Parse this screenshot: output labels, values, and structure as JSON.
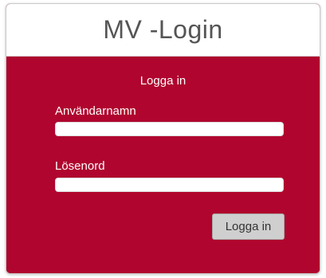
{
  "header": {
    "title": "MV -Login"
  },
  "form": {
    "subtitle": "Logga in",
    "username_label": "Användarnamn",
    "username_value": "",
    "password_label": "Lösenord",
    "password_value": "",
    "submit_label": "Logga in"
  },
  "colors": {
    "brand": "#b0052e",
    "header_bg": "#ffffff",
    "button_bg": "#cfcfcf"
  }
}
